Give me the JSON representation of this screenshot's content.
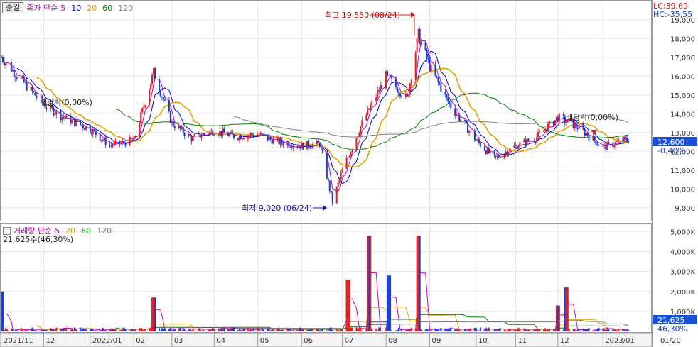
{
  "price_panel": {
    "mode_button": "승일",
    "legend_title": "종가 단순",
    "ma_periods": [
      "5",
      "10",
      "20",
      "60",
      "120"
    ],
    "ma_colors": [
      "#c000c0",
      "#0000c0",
      "#e0a000",
      "#008000",
      "#808080"
    ],
    "lc_label": "LC:39,69",
    "hc_label": "HC:-35,55",
    "current_price": "12,600",
    "current_change": "-0,40%",
    "high_note": "최고 19,550 (08/24)",
    "low_note": "최저 9,020 (06/24)",
    "dividend_note_1": "배당락(0,00%)",
    "dividend_note_2": "배당락(0,00%)",
    "y_ticks": [
      "19,000",
      "18,000",
      "17,000",
      "16,000",
      "15,000",
      "14,000",
      "13,000",
      "12,000",
      "11,000",
      "10,000",
      "9,000"
    ]
  },
  "volume_panel": {
    "legend_title": "거래량 단순",
    "ma_periods": [
      "5",
      "20",
      "60",
      "120"
    ],
    "ma_colors": [
      "#c000c0",
      "#e0a000",
      "#008000",
      "#808080"
    ],
    "current_volume_note": "21,625주(46,30%)",
    "current_volume": "21,625",
    "current_volume_pct": "46,30%",
    "y_ticks": [
      "5,000K",
      "4,000K",
      "3,000K",
      "2,000K",
      "1,000K"
    ]
  },
  "x_axis": {
    "labels": [
      "2021/11",
      "12",
      "2022/01",
      "02",
      "03",
      "04",
      "05",
      "06",
      "07",
      "08",
      "09",
      "10",
      "11",
      "12",
      "2023/01",
      "01/20"
    ]
  },
  "colors": {
    "up": "#e02020",
    "down": "#1a3fd0",
    "price_box": "#1a4fd8",
    "lc_hc": "#d02020",
    "grid": "#e6e6e6"
  },
  "chart_data": [
    {
      "type": "candlestick",
      "title": "",
      "ylim": [
        8500,
        19900
      ],
      "y_ticks": [
        9000,
        10000,
        11000,
        12000,
        13000,
        14000,
        15000,
        16000,
        17000,
        18000,
        19000
      ],
      "annotations": [
        {
          "text": "최고 19,550 (08/24)",
          "date": "2022/08/24",
          "value": 19550
        },
        {
          "text": "최저 9,020 (06/24)",
          "date": "2022/06/24",
          "value": 9020
        },
        {
          "text": "배당락(0,00%)",
          "date": "2021/12/29",
          "value": 14400
        },
        {
          "text": "배당락(0,00%)",
          "date": "2022/12/28",
          "value": 13800
        }
      ],
      "series": [
        {
          "name": "종가",
          "x": [
            "2021-11-01",
            "2021-11-15",
            "2021-12-01",
            "2021-12-15",
            "2022-01-03",
            "2022-01-17",
            "2022-02-03",
            "2022-02-17",
            "2022-03-02",
            "2022-03-16",
            "2022-04-01",
            "2022-04-15",
            "2022-05-02",
            "2022-05-16",
            "2022-06-02",
            "2022-06-15",
            "2022-06-24",
            "2022-07-01",
            "2022-07-15",
            "2022-08-01",
            "2022-08-16",
            "2022-08-24",
            "2022-09-01",
            "2022-09-15",
            "2022-10-04",
            "2022-10-17",
            "2022-11-01",
            "2022-11-15",
            "2022-12-01",
            "2022-12-15",
            "2023-01-02",
            "2023-01-16"
          ],
          "values": [
            17000,
            15800,
            14500,
            13800,
            13200,
            12300,
            12600,
            16200,
            13500,
            12700,
            13100,
            12800,
            12900,
            12500,
            12300,
            12400,
            9300,
            11000,
            13500,
            16000,
            14800,
            18200,
            16500,
            14500,
            12600,
            11600,
            12300,
            12700,
            13800,
            13300,
            12200,
            12600
          ]
        }
      ]
    },
    {
      "type": "bar",
      "title": "",
      "ylim": [
        0,
        5300
      ],
      "ylabel": "K",
      "y_ticks": [
        1000,
        2000,
        3000,
        4000,
        5000
      ],
      "annotations": [
        {
          "text": "21,625주(46,30%)"
        }
      ],
      "series": [
        {
          "name": "거래량",
          "x": [
            "2021-11-01",
            "2022-02-17",
            "2022-07-05",
            "2022-07-20",
            "2022-08-03",
            "2022-08-24",
            "2022-12-01",
            "2022-12-07"
          ],
          "values": [
            2000,
            1700,
            2600,
            4800,
            2800,
            4800,
            1300,
            2200
          ]
        }
      ]
    }
  ]
}
